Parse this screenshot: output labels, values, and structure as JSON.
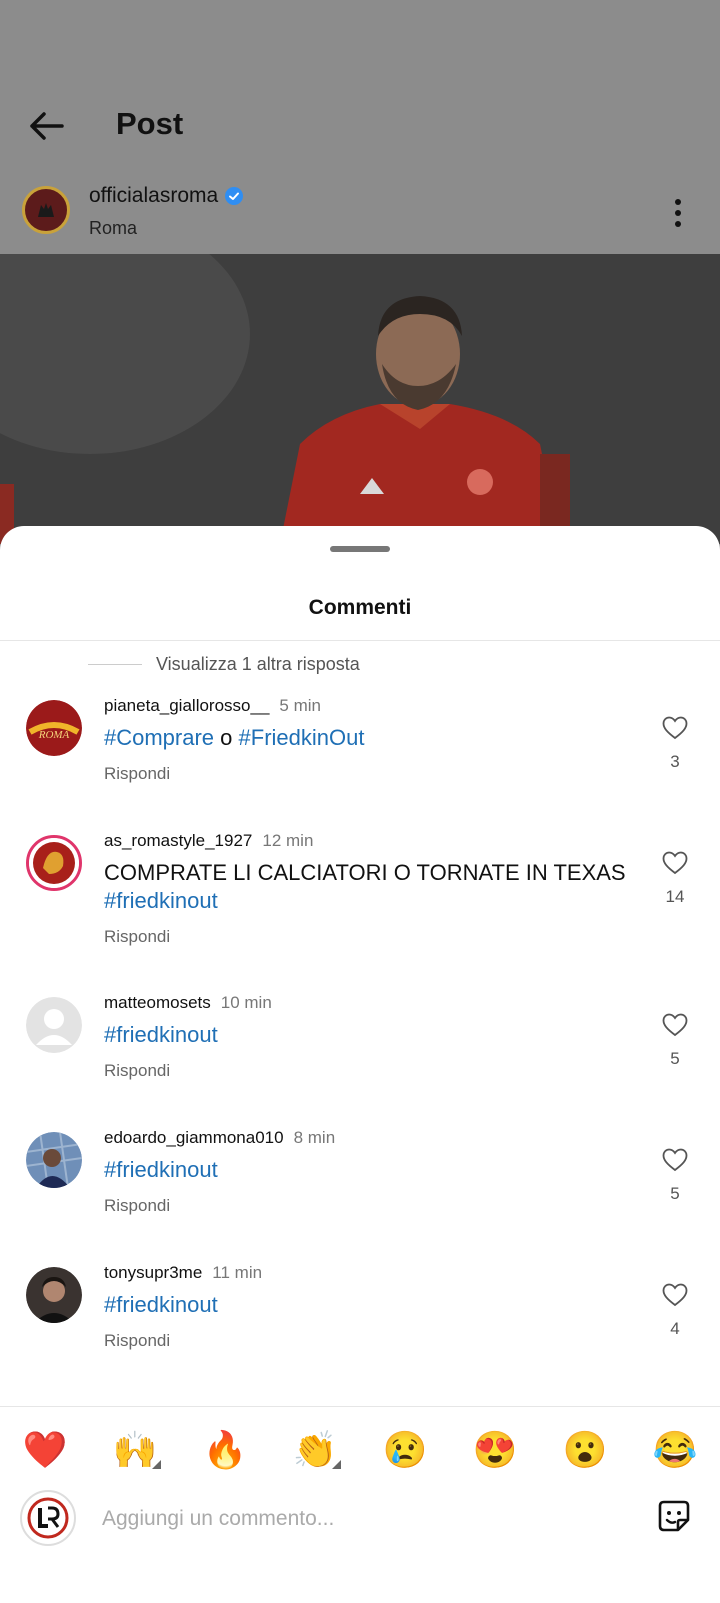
{
  "header": {
    "title": "Post"
  },
  "post": {
    "username": "officialasroma",
    "location": "Roma"
  },
  "sheet": {
    "title": "Commenti",
    "more_replies": "Visualizza 1 altra risposta"
  },
  "comments": [
    {
      "user": "pianeta_giallorosso__",
      "time": "5 min",
      "text_tag1": "#Comprare",
      "text_mid": " o ",
      "text_tag2": "#FriedkinOut",
      "reply": "Rispondi",
      "likes": "3"
    },
    {
      "user": "as_romastyle_1927",
      "time": "12 min",
      "text": "COMPRATE LI CALCIATORI O TORNATE IN TEXAS",
      "tag": "#friedkinout",
      "reply": "Rispondi",
      "likes": "14"
    },
    {
      "user": "matteomosets",
      "time": "10 min",
      "tag": "#friedkinout",
      "reply": "Rispondi",
      "likes": "5"
    },
    {
      "user": "edoardo_giammona010",
      "time": "8 min",
      "tag": "#friedkinout",
      "reply": "Rispondi",
      "likes": "5"
    },
    {
      "user": "tonysupr3me",
      "time": "11 min",
      "tag": "#friedkinout",
      "reply": "Rispondi",
      "likes": "4"
    }
  ],
  "emoji_bar": [
    "❤️",
    "🙌",
    "🔥",
    "👏",
    "😢",
    "😍",
    "😮",
    "😂"
  ],
  "composer": {
    "placeholder": "Aggiungi un commento..."
  },
  "colors": {
    "hashtag": "#1f6fb5",
    "verified": "#2f8ef3",
    "heart": "#e0162b"
  },
  "icons": [
    "back-arrow-icon",
    "verified-badge-icon",
    "more-vertical-icon",
    "heart-outline-icon",
    "sticker-icon"
  ]
}
